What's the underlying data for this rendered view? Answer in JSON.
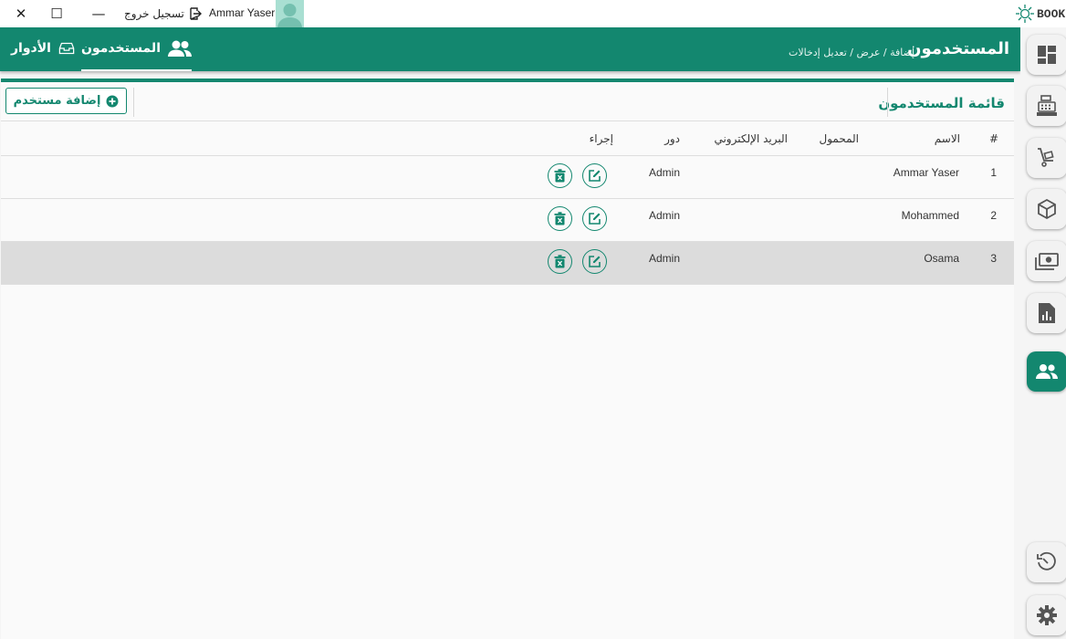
{
  "titlebar": {
    "close_glyph": "✕",
    "maximize_glyph": "☐",
    "minimize_glyph": "—",
    "logout_label": "تسجيل خروج",
    "username": "Ammar Yaser",
    "brand": "BOOK"
  },
  "tabs": [
    {
      "label": "المستخدمون",
      "icon": "users-icon",
      "active": true
    },
    {
      "label": "الأدوار",
      "icon": "roles-icon",
      "active": false
    }
  ],
  "header": {
    "title": "المستخدمون",
    "breadcrumb": "إضافة / عرض / تعديل إدخالات"
  },
  "card": {
    "title": "قائمة المستخدمون",
    "add_button_label": "إضافة مستخدم"
  },
  "table": {
    "columns": {
      "index": "#",
      "name": "الاسم",
      "mobile": "المحمول",
      "email": "البريد الإلكتروني",
      "role": "دور",
      "action": "إجراء"
    },
    "rows": [
      {
        "index": "1",
        "name": "Ammar Yaser",
        "mobile": "",
        "email": "",
        "role": "Admin"
      },
      {
        "index": "2",
        "name": "Mohammed",
        "mobile": "",
        "email": "",
        "role": "Admin"
      },
      {
        "index": "3",
        "name": "Osama",
        "mobile": "",
        "email": "",
        "role": "Admin"
      }
    ]
  },
  "sidebar": {
    "items": [
      "dashboard-icon",
      "cash-register-icon",
      "cart-icon",
      "box-icon",
      "money-icon",
      "report-icon",
      "users-icon",
      "history-icon",
      "settings-icon"
    ],
    "active": "users-icon"
  },
  "colors": {
    "primary": "#13876f",
    "highlight_row": "#dcdcdc",
    "background": "#f5f5f5"
  }
}
